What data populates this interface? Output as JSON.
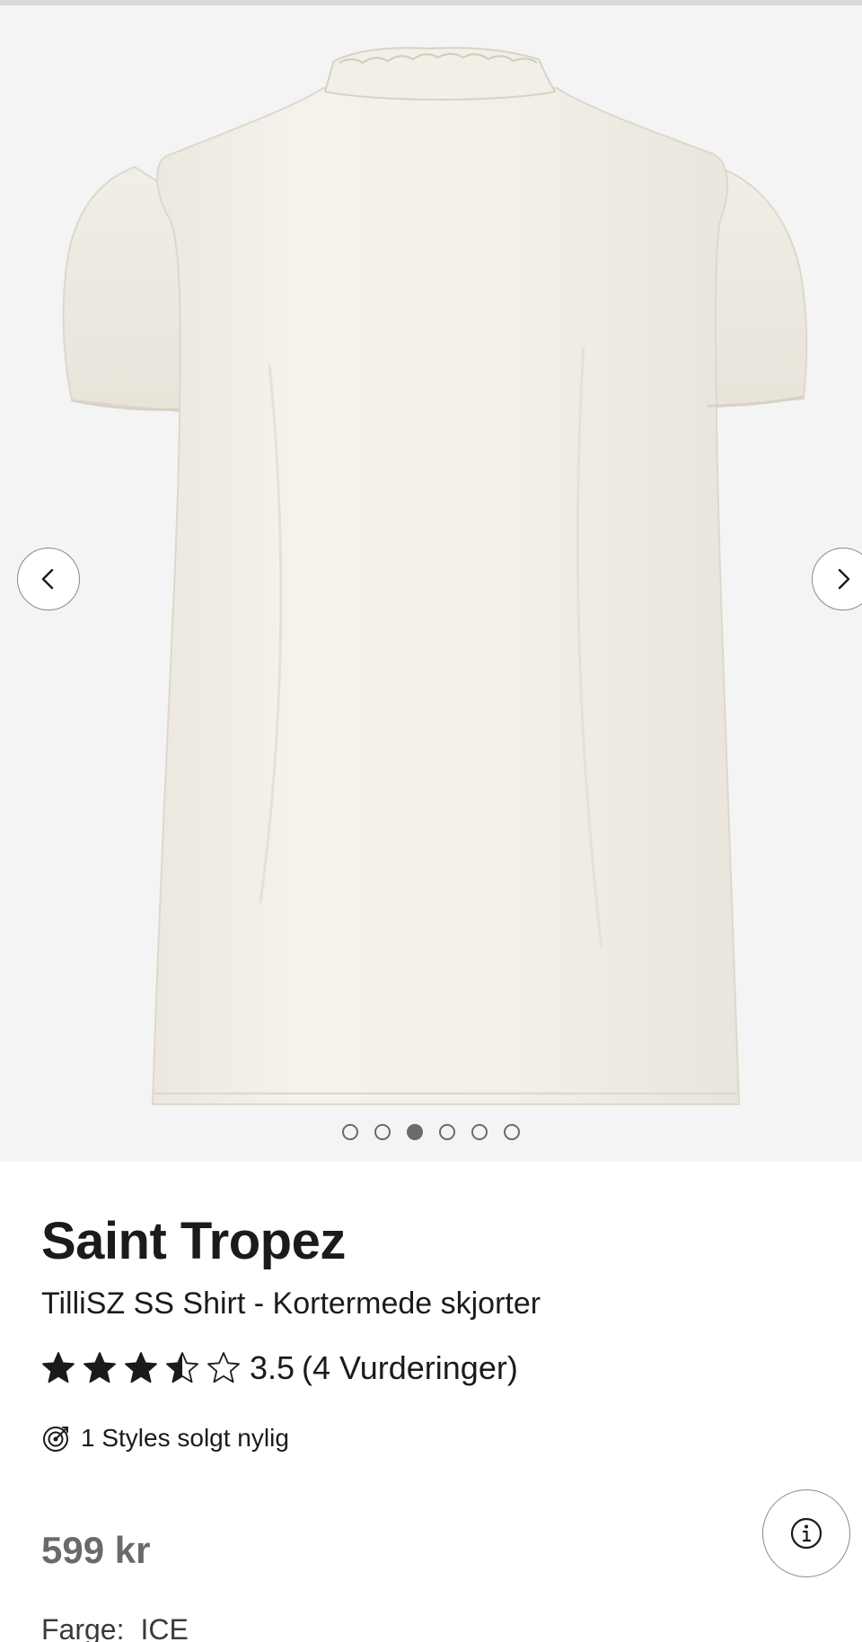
{
  "gallery": {
    "image_icon": "white-short-sleeve-shirt-back-view",
    "prev_icon": "chevron-left-icon",
    "next_icon": "chevron-right-icon",
    "dot_count": 6,
    "active_dot_index": 2
  },
  "product": {
    "brand": "Saint Tropez",
    "subtitle": "TilliSZ SS Shirt - Kortermede skjorter",
    "rating": {
      "value": 3.5,
      "value_text": "3.5",
      "reviews_text": "(4 Vurderinger)",
      "stars_max": 5
    },
    "sold_text": "1 Styles solgt nylig",
    "sold_icon": "target-icon",
    "price": "599 kr",
    "info_icon": "info-icon",
    "color_label": "Farge:",
    "color_value": "ICE"
  },
  "colors": {
    "gallery_bg": "#f4f4f4",
    "text": "#1b1b1b",
    "price": "#6a6a6a"
  }
}
